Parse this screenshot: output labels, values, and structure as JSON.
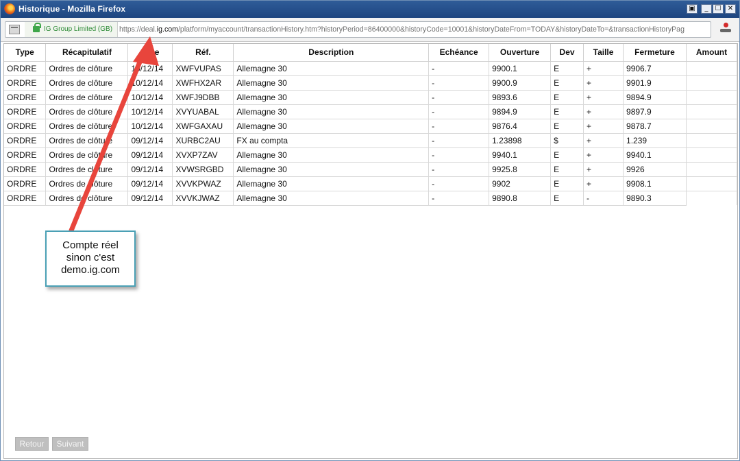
{
  "window": {
    "title": "Historique - Mozilla Firefox",
    "controls": [
      "▣",
      "_",
      "☐",
      "✕"
    ]
  },
  "urlbar": {
    "identity": "IG Group Limited (GB)",
    "url_prefix": "https://deal.",
    "url_domain": "ig.com",
    "url_rest": "/platform/myaccount/transactionHistory.htm?historyPeriod=86400000&historyCode=10001&historyDateFrom=TODAY&historyDateTo=&transactionHistoryPag"
  },
  "table": {
    "headers": [
      "Type",
      "Récapitulatif",
      "Date",
      "Réf.",
      "Description",
      "Echéance",
      "Ouverture",
      "Dev",
      "Taille",
      "Fermeture",
      "Amount"
    ],
    "header_date_visible": "e",
    "rows": [
      [
        "ORDRE",
        "Ordres de clôture",
        "10/12/14",
        "XWFVUPAS",
        "Allemagne 30",
        "-",
        "9900.1",
        "E",
        "+",
        "9906.7",
        ""
      ],
      [
        "ORDRE",
        "Ordres de clôture",
        "10/12/14",
        "XWFHX2AR",
        "Allemagne 30",
        "-",
        "9900.9",
        "E",
        "+",
        "9901.9",
        ""
      ],
      [
        "ORDRE",
        "Ordres de clôture",
        "10/12/14",
        "XWFJ9DBB",
        "Allemagne 30",
        "-",
        "9893.6",
        "E",
        "+",
        "9894.9",
        ""
      ],
      [
        "ORDRE",
        "Ordres de clôture",
        "10/12/14",
        "XVYUABAL",
        "Allemagne 30",
        "-",
        "9894.9",
        "E",
        "+",
        "9897.9",
        ""
      ],
      [
        "ORDRE",
        "Ordres de clôture",
        "10/12/14",
        "XWFGAXAU",
        "Allemagne 30",
        "-",
        "9876.4",
        "E",
        "+",
        "9878.7",
        ""
      ],
      [
        "ORDRE",
        "Ordres de clôture",
        "09/12/14",
        "XURBC2AU",
        "FX au compta",
        "-",
        "1.23898",
        "$",
        "+",
        "1.239",
        ""
      ],
      [
        "ORDRE",
        "Ordres de clôture",
        "09/12/14",
        "XVXP7ZAV",
        "Allemagne 30",
        "-",
        "9940.1",
        "E",
        "+",
        "9940.1",
        ""
      ],
      [
        "ORDRE",
        "Ordres de clôture",
        "09/12/14",
        "XVWSRGBD",
        "Allemagne 30",
        "-",
        "9925.8",
        "E",
        "+",
        "9926",
        ""
      ],
      [
        "ORDRE",
        "Ordres de clôture",
        "09/12/14",
        "XVVKPWAZ",
        "Allemagne 30",
        "-",
        "9902",
        "E",
        "+",
        "9908.1",
        ""
      ],
      [
        "ORDRE",
        "Ordres de clôture",
        "09/12/14",
        "XVVKJWAZ",
        "Allemagne 30",
        "-",
        "9890.8",
        "E",
        "-",
        "9890.3",
        ""
      ]
    ]
  },
  "pager": {
    "back": "Retour",
    "next": "Suivant"
  },
  "annotation": {
    "lines": [
      "Compte réel",
      "sinon c'est",
      "demo.ig.com"
    ],
    "arrow_color": "#e8453c",
    "box_border": "#4aa0b5"
  }
}
